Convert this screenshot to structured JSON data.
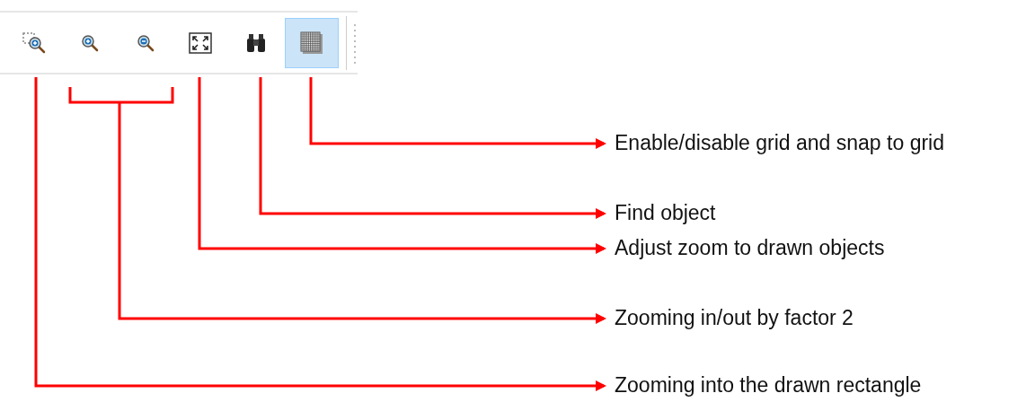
{
  "toolbar": {
    "buttons": [
      {
        "kind": "zoom-rect",
        "selected": false
      },
      {
        "kind": "zoom-in",
        "selected": false
      },
      {
        "kind": "zoom-out",
        "selected": false
      },
      {
        "kind": "zoom-fit",
        "selected": false
      },
      {
        "kind": "find",
        "selected": false
      },
      {
        "kind": "grid",
        "selected": true
      }
    ]
  },
  "callouts": [
    {
      "kind": "single",
      "label": "Enable/disable grid and snap to grid"
    },
    {
      "kind": "single",
      "label": "Find object"
    },
    {
      "kind": "single",
      "label": "Adjust zoom to drawn objects"
    },
    {
      "kind": "bracket",
      "label": "Zooming in/out by factor 2"
    },
    {
      "kind": "single",
      "label": "Zooming into the drawn rectangle"
    }
  ]
}
